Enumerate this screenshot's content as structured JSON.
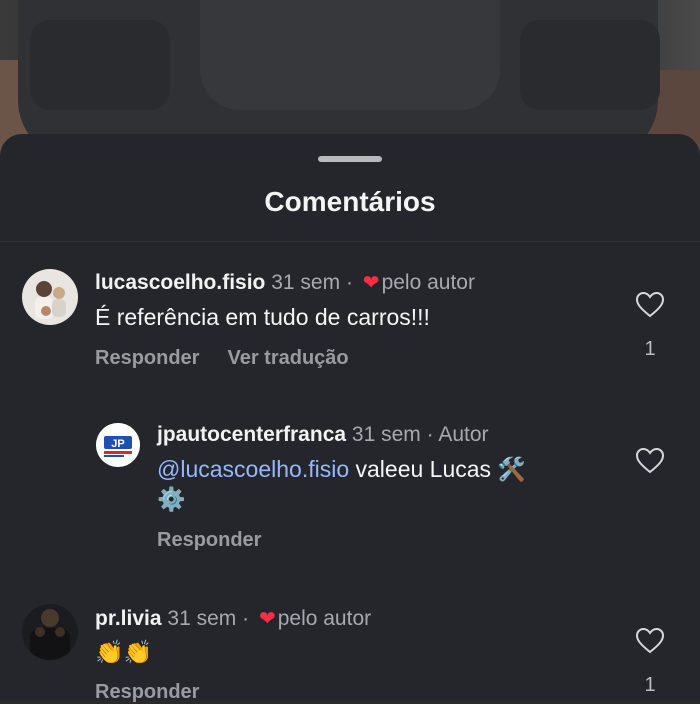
{
  "sheet": {
    "title": "Comentários"
  },
  "comments": [
    {
      "username": "lucascoelho.fisio",
      "time": "31 sem",
      "badge": "pelo autor",
      "text": "É  referência em tudo de carros!!!",
      "reply_label": "Responder",
      "translate_label": "Ver tradução",
      "like_count": "1"
    },
    {
      "username": "jpautocenterfranca",
      "time": "31 sem",
      "badge": "Autor",
      "mention": "@lucascoelho.fisio",
      "text": " valeeu Lucas 🛠️",
      "text_line2": "⚙️",
      "reply_label": "Responder"
    },
    {
      "username": "pr.livia",
      "time": "31 sem",
      "badge": "pelo autor",
      "text": "👏👏",
      "reply_label": "Responder",
      "like_count": "1"
    }
  ],
  "colors": {
    "heart": "#ff2d44",
    "mention": "#95b8ff",
    "sheet_bg": "#25262b"
  }
}
